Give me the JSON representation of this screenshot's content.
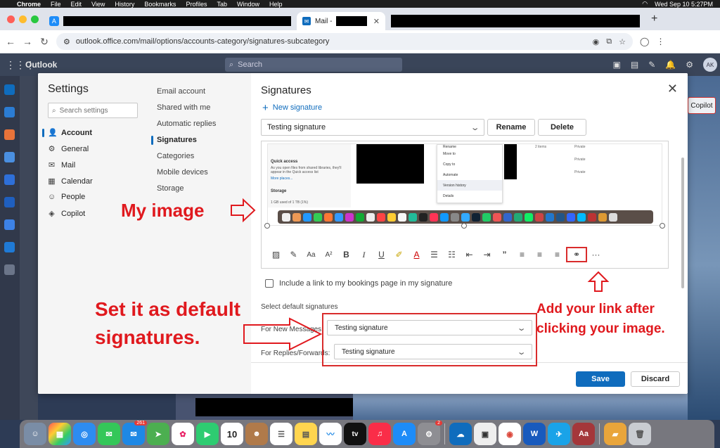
{
  "menubar": {
    "app": "Chrome",
    "items": [
      "File",
      "Edit",
      "View",
      "History",
      "Bookmarks",
      "Profiles",
      "Tab",
      "Window",
      "Help"
    ],
    "clock": "Wed Sep 10  5:27PM"
  },
  "browser": {
    "active_tab_title": "Mail -",
    "url": "outlook.office.com/mail/options/accounts-category/signatures-subcategory"
  },
  "outlook": {
    "brand": "Outlook",
    "search_placeholder": "Search",
    "avatar_initials": "AK",
    "copilot_label": "Copilot"
  },
  "settings": {
    "title": "Settings",
    "search_placeholder": "Search settings",
    "categories": [
      {
        "label": "Account",
        "icon": "person-icon",
        "glyph": "👤"
      },
      {
        "label": "General",
        "icon": "gear-icon",
        "glyph": "⚙"
      },
      {
        "label": "Mail",
        "icon": "mail-icon",
        "glyph": "✉"
      },
      {
        "label": "Calendar",
        "icon": "calendar-icon",
        "glyph": "▦"
      },
      {
        "label": "People",
        "icon": "people-icon",
        "glyph": "☺"
      },
      {
        "label": "Copilot",
        "icon": "copilot-icon",
        "glyph": "◈"
      }
    ],
    "subcategories": [
      "Email account",
      "Shared with me",
      "Automatic replies",
      "Signatures",
      "Categories",
      "Mobile devices",
      "Storage"
    ]
  },
  "signatures": {
    "title": "Signatures",
    "new_signature": "New signature",
    "selected_signature": "Testing signature",
    "rename_label": "Rename",
    "delete_label": "Delete",
    "embedded_image": {
      "sidebar_heading": "Quick access",
      "sidebar_text": "As you open files from shared libraries, they'll appear in the Quick access list",
      "sidebar_link": "More places...",
      "storage_heading": "Storage",
      "storage_text": "1 GB used of 1 TB (1%)",
      "menu_items": [
        "Rename",
        "Move to",
        "Copy to",
        "Automate",
        "Version history",
        "Details"
      ],
      "right_items": [
        "2 items",
        "Private",
        "Private",
        "Private"
      ]
    },
    "bookings_label": "Include a link to my bookings page in my signature",
    "default_heading": "Select default signatures",
    "new_messages_label": "For New Messages:",
    "new_messages_value": "Testing signature",
    "replies_label": "For Replies/Forwards:",
    "replies_value": "Testing signature",
    "save_label": "Save",
    "discard_label": "Discard"
  },
  "annotations": {
    "my_image": "My image",
    "default_line1": "Set it as default",
    "default_line2": "signatures.",
    "link_line1": "Add your link after",
    "link_line2": "clicking your image."
  },
  "dock": {
    "mail_badge": "261",
    "calendar_day": "10",
    "settings_badge": "2",
    "tv_label": "tv"
  },
  "colors": {
    "accent": "#0f6cbd",
    "annotation_red": "#e0191e"
  }
}
